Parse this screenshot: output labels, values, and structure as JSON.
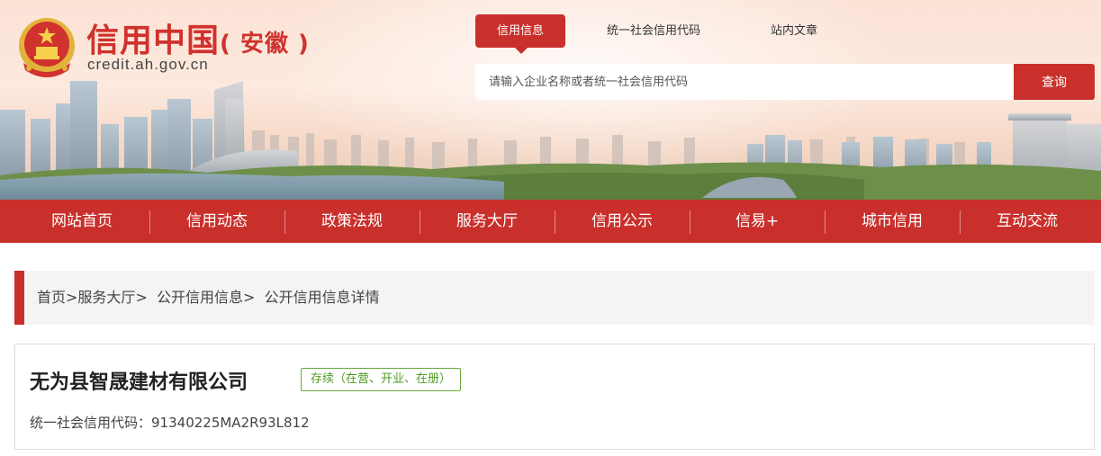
{
  "site": {
    "title": "信用中国",
    "province": "( 安徽 )",
    "domain": "credit.ah.gov.cn",
    "emblem": "national-emblem-icon"
  },
  "search": {
    "tabs": [
      "信用信息",
      "统一社会信用代码",
      "站内文章"
    ],
    "active_tab": 0,
    "placeholder": "请输入企业名称或者统一社会信用代码",
    "value": "",
    "button_label": "查询"
  },
  "nav": {
    "items": [
      "网站首页",
      "信用动态",
      "政策法规",
      "服务大厅",
      "信用公示",
      "信易+",
      "城市信用",
      "互动交流"
    ]
  },
  "breadcrumb": {
    "items": [
      "首页",
      "服务大厅",
      "公开信用信息",
      "公开信用信息详情"
    ],
    "separator": ">"
  },
  "company": {
    "name": "无为县智晟建材有限公司",
    "status": "存续（在营、开业、在册）",
    "credit_code_label": "统一社会信用代码：",
    "credit_code": "91340225MA2R93L812"
  },
  "colors": {
    "brand_red": "#c9302c",
    "status_green": "#4e9a23",
    "breadcrumb_bg": "#f4f4f4"
  }
}
